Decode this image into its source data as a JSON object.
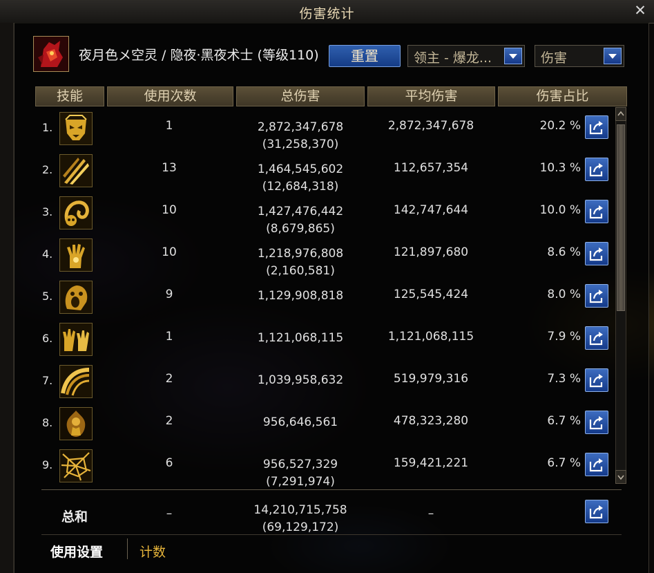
{
  "window": {
    "title": "伤害统计",
    "close_label": "✕"
  },
  "header": {
    "character": "夜月色メ空灵 / 隐夜·黑夜术士 (等级110)",
    "reset_label": "重置",
    "target_dropdown": "领主 - 爆龙...",
    "mode_dropdown": "伤害"
  },
  "columns": [
    "技能",
    "使用次数",
    "总伤害",
    "平均伤害",
    "伤害占比"
  ],
  "rows": [
    {
      "num": "1.",
      "uses": "1",
      "total": "2,872,347,678",
      "sub": "(31,258,370)",
      "avg": "2,872,347,678",
      "pct": "20.2 %",
      "icon": "golden-mask-skill-icon"
    },
    {
      "num": "2.",
      "uses": "13",
      "total": "1,464,545,602",
      "sub": "(12,684,318)",
      "avg": "112,657,354",
      "pct": "10.3 %",
      "icon": "claw-slash-skill-icon"
    },
    {
      "num": "3.",
      "uses": "10",
      "total": "1,427,476,442",
      "sub": "(8,679,865)",
      "avg": "142,747,644",
      "pct": "10.0 %",
      "icon": "skull-serpent-skill-icon"
    },
    {
      "num": "4.",
      "uses": "10",
      "total": "1,218,976,808",
      "sub": "(2,160,581)",
      "avg": "121,897,680",
      "pct": "8.6 %",
      "icon": "rising-hand-skill-icon"
    },
    {
      "num": "5.",
      "uses": "9",
      "total": "1,129,908,818",
      "sub": "",
      "avg": "125,545,424",
      "pct": "8.0 %",
      "icon": "screaming-face-skill-icon"
    },
    {
      "num": "6.",
      "uses": "1",
      "total": "1,121,068,115",
      "sub": "",
      "avg": "1,121,068,115",
      "pct": "7.9 %",
      "icon": "twin-hands-skill-icon"
    },
    {
      "num": "7.",
      "uses": "2",
      "total": "1,039,958,632",
      "sub": "",
      "avg": "519,979,316",
      "pct": "7.3 %",
      "icon": "sweeping-arc-skill-icon"
    },
    {
      "num": "8.",
      "uses": "2",
      "total": "956,646,561",
      "sub": "",
      "avg": "478,323,280",
      "pct": "6.7 %",
      "icon": "burning-figure-skill-icon"
    },
    {
      "num": "9.",
      "uses": "6",
      "total": "956,527,329",
      "sub": "(7,291,974)",
      "avg": "159,421,221",
      "pct": "6.7 %",
      "icon": "shatter-web-skill-icon"
    }
  ],
  "summary": {
    "label": "总和",
    "uses": "–",
    "total": "14,210,715,758",
    "sub": "(69,129,172)",
    "avg": "–"
  },
  "tabs": [
    {
      "label": "使用设置",
      "color": "#ffffff"
    },
    {
      "label": "计数",
      "color": "#e6b43a"
    }
  ],
  "colors": {
    "accent_blue": "#1d4c9e",
    "header_gold": "#4a4030",
    "tab_active": "#e6b43a"
  }
}
